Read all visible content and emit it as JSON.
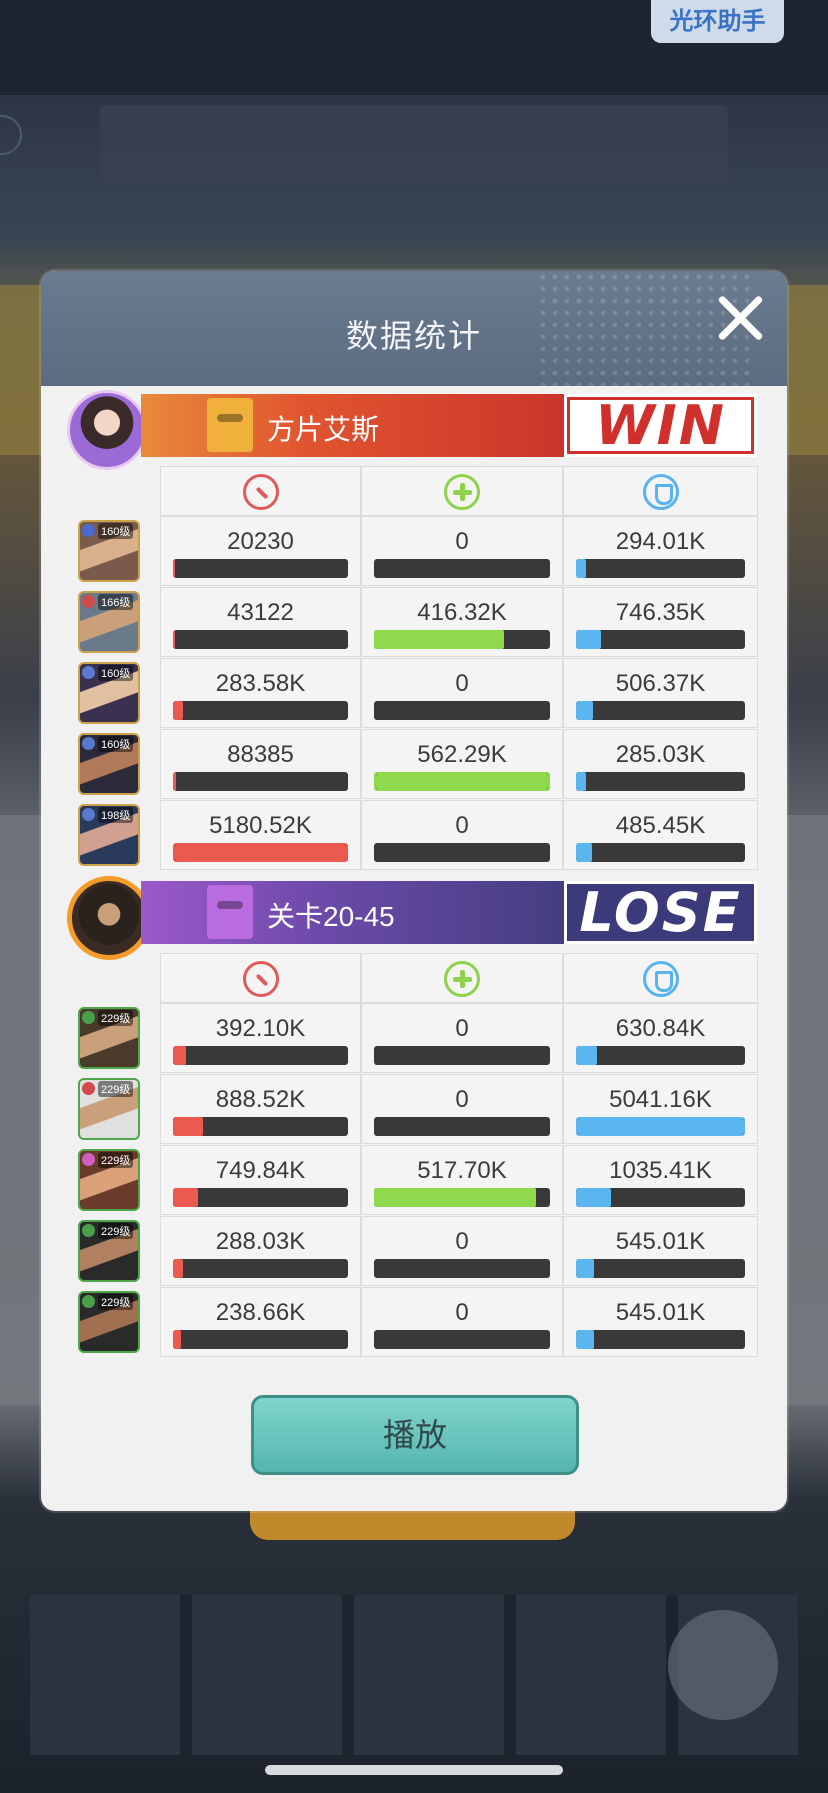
{
  "assist_button": "光环助手",
  "modal": {
    "title": "数据统计"
  },
  "colors": {
    "attack": "#ea5a4e",
    "heal": "#8fd94c",
    "defense": "#5bb6f0",
    "win": "#d0302c",
    "lose": "#3b3a7a",
    "play": "#6cc6be"
  },
  "stat_icons": [
    "attack-icon",
    "heal-icon",
    "shield-icon"
  ],
  "teams": [
    {
      "name": "方片艾斯",
      "result": "WIN",
      "heroes": [
        {
          "level": "160级",
          "damage": "20230",
          "damage_ratio": 0.004,
          "heal": "0",
          "heal_ratio": 0,
          "taken": "294.01K",
          "taken_ratio": 0.058
        },
        {
          "level": "166级",
          "damage": "43122",
          "damage_ratio": 0.008,
          "heal": "416.32K",
          "heal_ratio": 0.74,
          "taken": "746.35K",
          "taken_ratio": 0.148
        },
        {
          "level": "160级",
          "damage": "283.58K",
          "damage_ratio": 0.055,
          "heal": "0",
          "heal_ratio": 0,
          "taken": "506.37K",
          "taken_ratio": 0.1
        },
        {
          "level": "160级",
          "damage": "88385",
          "damage_ratio": 0.017,
          "heal": "562.29K",
          "heal_ratio": 1.0,
          "taken": "285.03K",
          "taken_ratio": 0.057
        },
        {
          "level": "198级",
          "damage": "5180.52K",
          "damage_ratio": 1.0,
          "heal": "0",
          "heal_ratio": 0,
          "taken": "485.45K",
          "taken_ratio": 0.096
        }
      ]
    },
    {
      "name": "关卡20-45",
      "result": "LOSE",
      "heroes": [
        {
          "level": "229级",
          "damage": "392.10K",
          "damage_ratio": 0.075,
          "heal": "0",
          "heal_ratio": 0,
          "taken": "630.84K",
          "taken_ratio": 0.125
        },
        {
          "level": "229级",
          "damage": "888.52K",
          "damage_ratio": 0.17,
          "heal": "0",
          "heal_ratio": 0,
          "taken": "5041.16K",
          "taken_ratio": 1.0
        },
        {
          "level": "229级",
          "damage": "749.84K",
          "damage_ratio": 0.144,
          "heal": "517.70K",
          "heal_ratio": 0.92,
          "taken": "1035.41K",
          "taken_ratio": 0.205
        },
        {
          "level": "229级",
          "damage": "288.03K",
          "damage_ratio": 0.055,
          "heal": "0",
          "heal_ratio": 0,
          "taken": "545.01K",
          "taken_ratio": 0.108
        },
        {
          "level": "229级",
          "damage": "238.66K",
          "damage_ratio": 0.046,
          "heal": "0",
          "heal_ratio": 0,
          "taken": "545.01K",
          "taken_ratio": 0.108
        }
      ]
    }
  ],
  "play_button": "播放"
}
